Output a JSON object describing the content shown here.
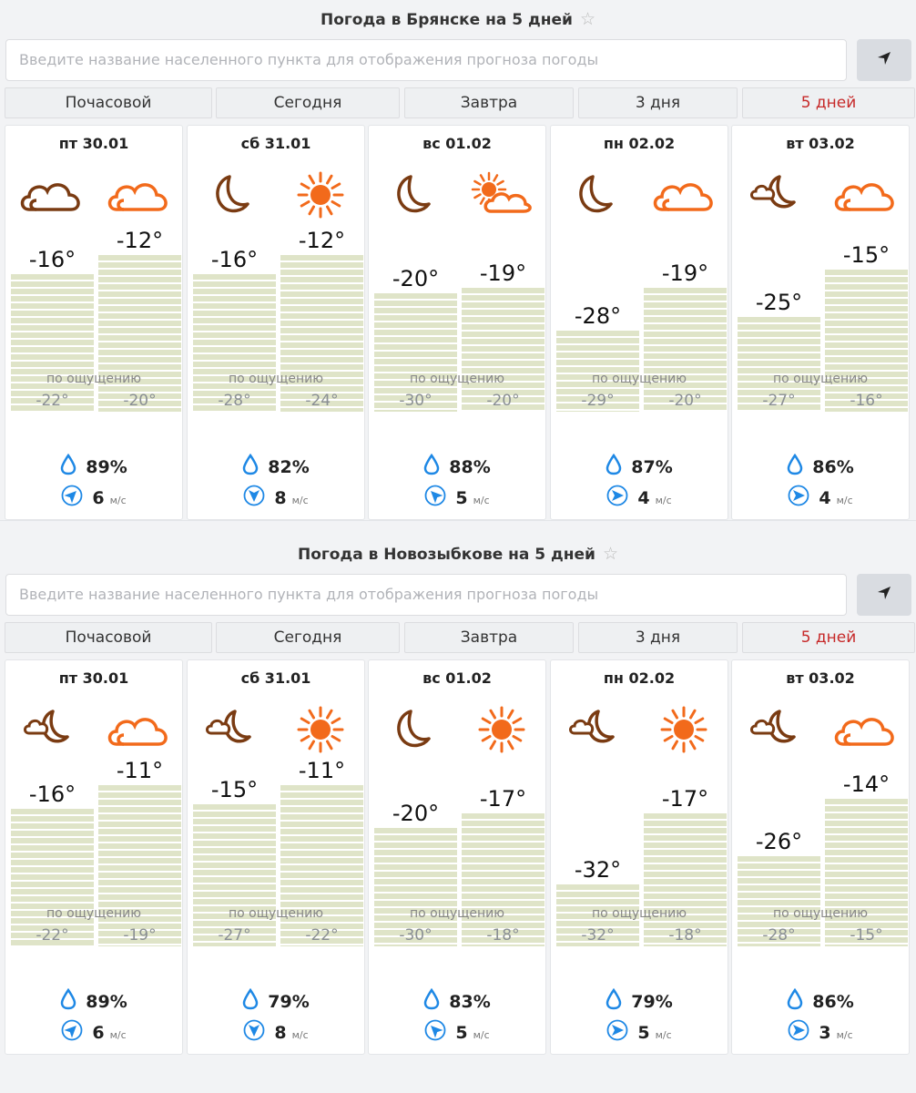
{
  "colors": {
    "accent_red": "#c62828",
    "cloud_orange": "#f26a1b",
    "moon_brown": "#7a3b12",
    "sun_orange": "#f26a1b",
    "water_blue": "#1e88e5"
  },
  "tabs": [
    {
      "label": "Почасовой"
    },
    {
      "label": "Сегодня"
    },
    {
      "label": "Завтра"
    },
    {
      "label": "3 дня"
    },
    {
      "label": "5 дней",
      "active": true
    }
  ],
  "feels_label": "по ощущению",
  "wind_unit": "м/с",
  "widgets": [
    {
      "title": "Погода в Брянске на 5 дней",
      "search_placeholder": "Введите название населенного пункта для отображения прогноза погоды",
      "days": [
        {
          "date": "пт 30.01",
          "night_icon": "cloud-icon",
          "day_icon": "cloud-icon",
          "low": "-16°",
          "high": "-12°",
          "low_value": -16,
          "high_value": -12,
          "feels_low": "-22°",
          "feels_high": "-20°",
          "humidity": "89%",
          "wind_speed": "6",
          "wind_dir": "northeast"
        },
        {
          "date": "сб 31.01",
          "night_icon": "moon-icon",
          "day_icon": "sun-icon",
          "low": "-16°",
          "high": "-12°",
          "low_value": -16,
          "high_value": -12,
          "feels_low": "-28°",
          "feels_high": "-24°",
          "humidity": "82%",
          "wind_speed": "8",
          "wind_dir": "south"
        },
        {
          "date": "вс 01.02",
          "night_icon": "moon-icon",
          "day_icon": "sun-cloud-icon",
          "low": "-20°",
          "high": "-19°",
          "low_value": -20,
          "high_value": -19,
          "feels_low": "-30°",
          "feels_high": "-20°",
          "humidity": "88%",
          "wind_speed": "5",
          "wind_dir": "northwest"
        },
        {
          "date": "пн 02.02",
          "night_icon": "moon-icon",
          "day_icon": "cloud-icon",
          "low": "-28°",
          "high": "-19°",
          "low_value": -28,
          "high_value": -19,
          "feels_low": "-29°",
          "feels_high": "-20°",
          "humidity": "87%",
          "wind_speed": "4",
          "wind_dir": "east"
        },
        {
          "date": "вт 03.02",
          "night_icon": "moon-cloud-icon",
          "day_icon": "cloud-icon",
          "low": "-25°",
          "high": "-15°",
          "low_value": -25,
          "high_value": -15,
          "feels_low": "-27°",
          "feels_high": "-16°",
          "humidity": "86%",
          "wind_speed": "4",
          "wind_dir": "east"
        }
      ]
    },
    {
      "title": "Погода в Новозыбкове на 5 дней",
      "search_placeholder": "Введите название населенного пункта для отображения прогноза погоды",
      "days": [
        {
          "date": "пт 30.01",
          "night_icon": "moon-cloud-icon",
          "day_icon": "cloud-icon",
          "low": "-16°",
          "high": "-11°",
          "low_value": -16,
          "high_value": -11,
          "feels_low": "-22°",
          "feels_high": "-19°",
          "humidity": "89%",
          "wind_speed": "6",
          "wind_dir": "northeast"
        },
        {
          "date": "сб 31.01",
          "night_icon": "moon-cloud-icon",
          "day_icon": "sun-icon",
          "low": "-15°",
          "high": "-11°",
          "low_value": -15,
          "high_value": -11,
          "feels_low": "-27°",
          "feels_high": "-22°",
          "humidity": "79%",
          "wind_speed": "8",
          "wind_dir": "south"
        },
        {
          "date": "вс 01.02",
          "night_icon": "moon-icon",
          "day_icon": "sun-icon",
          "low": "-20°",
          "high": "-17°",
          "low_value": -20,
          "high_value": -17,
          "feels_low": "-30°",
          "feels_high": "-18°",
          "humidity": "83%",
          "wind_speed": "5",
          "wind_dir": "northwest"
        },
        {
          "date": "пн 02.02",
          "night_icon": "moon-cloud-icon",
          "day_icon": "sun-icon",
          "low": "-32°",
          "high": "-17°",
          "low_value": -32,
          "high_value": -17,
          "feels_low": "-32°",
          "feels_high": "-18°",
          "humidity": "79%",
          "wind_speed": "5",
          "wind_dir": "east"
        },
        {
          "date": "вт 03.02",
          "night_icon": "moon-cloud-icon",
          "day_icon": "cloud-icon",
          "low": "-26°",
          "high": "-14°",
          "low_value": -26,
          "high_value": -14,
          "feels_low": "-28°",
          "feels_high": "-15°",
          "humidity": "86%",
          "wind_speed": "3",
          "wind_dir": "east"
        }
      ]
    }
  ]
}
